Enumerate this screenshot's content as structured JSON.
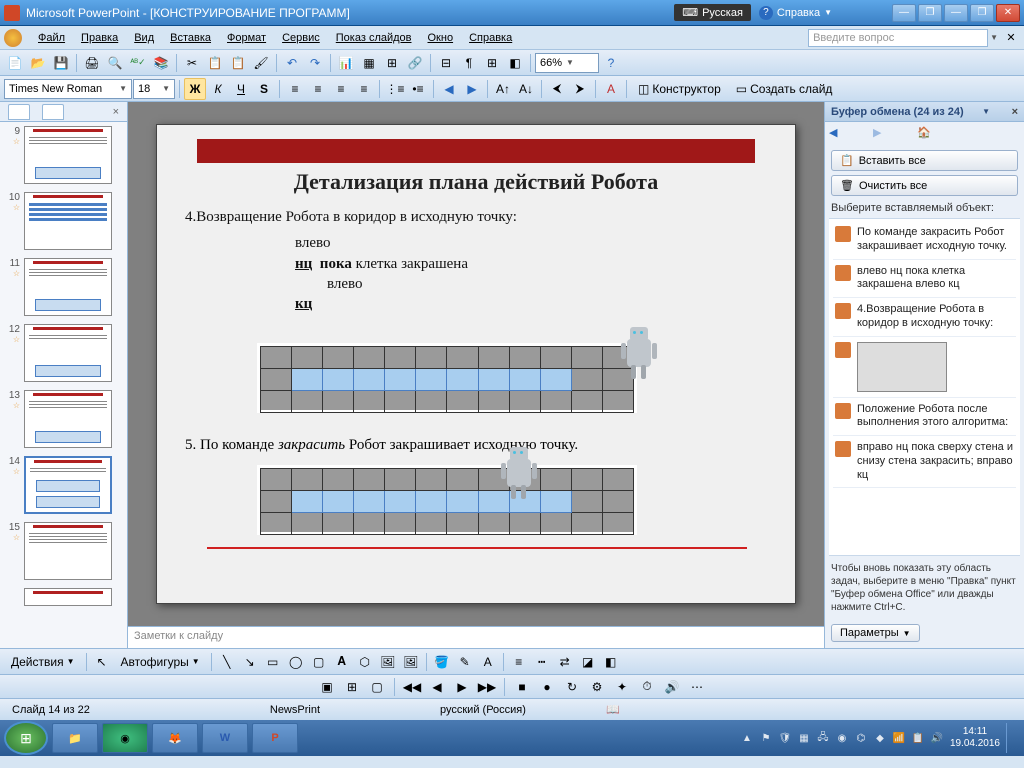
{
  "titlebar": {
    "app": "Microsoft PowerPoint - [КОНСТРУИРОВАНИЕ ПРОГРАММ]",
    "lang": "Русская",
    "help": "Справка"
  },
  "menu": {
    "items": [
      "Файл",
      "Правка",
      "Вид",
      "Вставка",
      "Формат",
      "Сервис",
      "Показ слайдов",
      "Окно",
      "Справка"
    ],
    "question_placeholder": "Введите вопрос"
  },
  "toolbar1": {
    "zoom": "66%"
  },
  "toolbar2": {
    "font": "Times New Roman",
    "size": "18",
    "bold": "Ж",
    "italic": "К",
    "underline": "Ч",
    "shadow": "S",
    "constructor": "Конструктор",
    "new_slide": "Создать слайд"
  },
  "thumbs": {
    "visible": [
      {
        "n": "9"
      },
      {
        "n": "10"
      },
      {
        "n": "11"
      },
      {
        "n": "12"
      },
      {
        "n": "13"
      },
      {
        "n": "14",
        "active": true
      },
      {
        "n": "15"
      }
    ]
  },
  "slide": {
    "title": "Детализация плана действий Робота",
    "step4": "4.Возвращение Робота в коридор в исходную точку:",
    "code": {
      "l1": "влево",
      "l2a": "нц",
      "l2b": "пока",
      "l2c": "клетка  закрашена",
      "l3": "влево",
      "l4": "кц"
    },
    "step5a": "5. По команде ",
    "step5b": "закрасить",
    "step5c": " Робот закрашивает исходную точку."
  },
  "notes": {
    "placeholder": "Заметки к слайду"
  },
  "clipboard": {
    "title": "Буфер обмена (24 из 24)",
    "paste_all": "Вставить все",
    "clear_all": "Очистить все",
    "choose": "Выберите вставляемый объект:",
    "items": [
      {
        "text": "По команде закрасить Робот закрашивает исходную точку."
      },
      {
        "text": "влево нц пока клетка закрашена влево кц"
      },
      {
        "text": "4.Возвращение Робота в коридор в исходную точку:"
      },
      {
        "thumb": true
      },
      {
        "text": "Положение Робота после выполнения этого алгоритма:"
      },
      {
        "text": "вправо нц пока сверху стена и снизу стена закрасить; вправо кц"
      }
    ],
    "hint": "Чтобы вновь показать эту область задач, выберите в меню \"Правка\" пункт \"Буфер обмена Office\" или дважды нажмите Ctrl+C.",
    "params": "Параметры"
  },
  "drawbar": {
    "actions": "Действия",
    "autoshapes": "Автофигуры"
  },
  "status": {
    "slide": "Слайд 14 из 22",
    "theme": "NewsPrint",
    "lang": "русский (Россия)"
  },
  "taskbar": {
    "time": "14:11",
    "date": "19.04.2016"
  }
}
